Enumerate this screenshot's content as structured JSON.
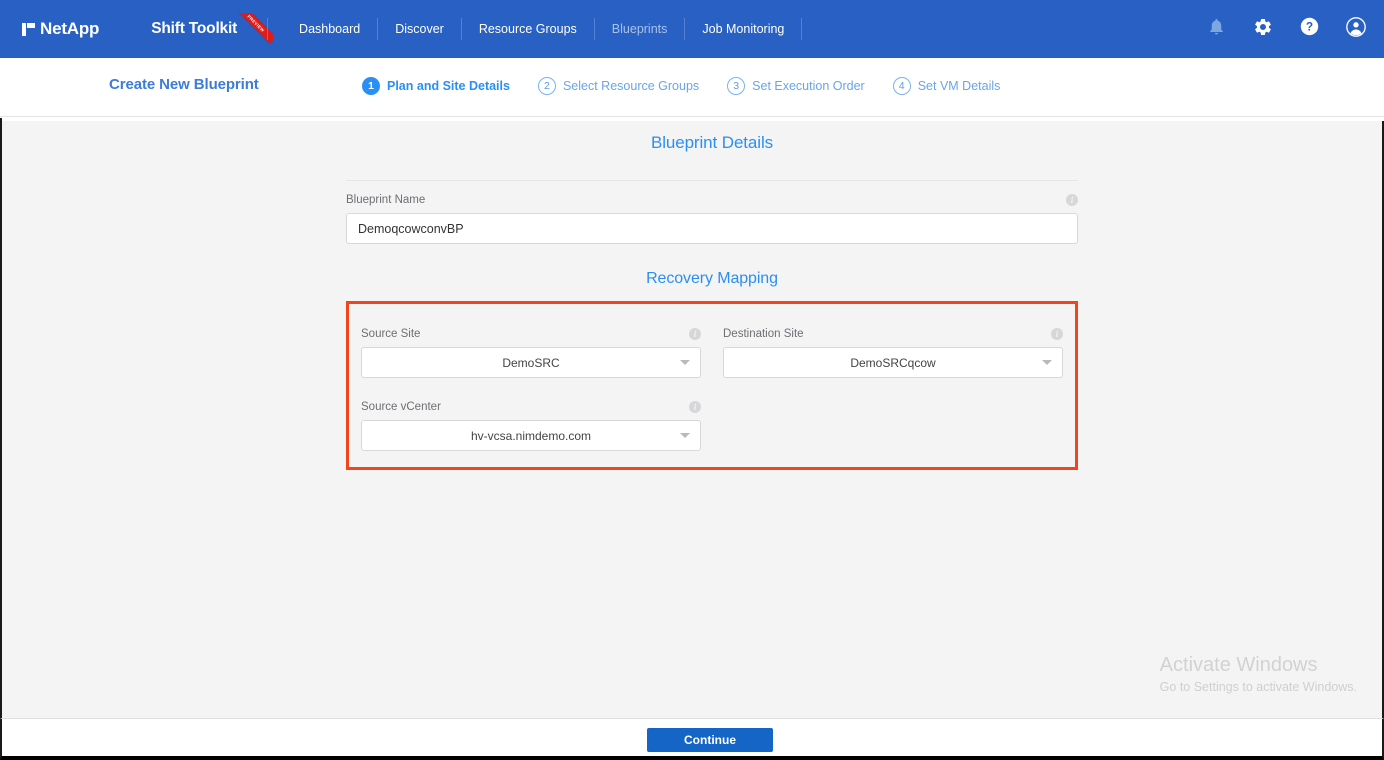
{
  "navbar": {
    "logo_text": "NetApp",
    "brand": "Shift Toolkit",
    "ribbon_label": "PREVIEW",
    "links": [
      {
        "label": "Dashboard",
        "state": "normal"
      },
      {
        "label": "Discover",
        "state": "normal"
      },
      {
        "label": "Resource Groups",
        "state": "normal"
      },
      {
        "label": "Blueprints",
        "state": "dim"
      },
      {
        "label": "Job Monitoring",
        "state": "normal"
      }
    ],
    "icons": [
      {
        "name": "notification-bell-icon"
      },
      {
        "name": "settings-gear-icon"
      },
      {
        "name": "help-icon"
      },
      {
        "name": "user-account-icon"
      }
    ],
    "accent_color": "#2860c4"
  },
  "wizard": {
    "title": "Create New Blueprint",
    "close_label": "✕",
    "steps": [
      {
        "num": "1",
        "label": "Plan and Site Details",
        "active": true
      },
      {
        "num": "2",
        "label": "Select Resource Groups",
        "active": false
      },
      {
        "num": "3",
        "label": "Set Execution Order",
        "active": false
      },
      {
        "num": "4",
        "label": "Set VM Details",
        "active": false
      }
    ]
  },
  "blueprint_details": {
    "heading": "Blueprint Details",
    "name_label": "Blueprint Name",
    "name_value": "DemoqcowconvBP",
    "name_placeholder": "Blueprint Name",
    "info_glyph": "i"
  },
  "recovery_mapping": {
    "heading": "Recovery Mapping",
    "highlight_color": "#f4441e",
    "fields": [
      {
        "label": "Source Site",
        "value": "DemoSRC"
      },
      {
        "label": "Destination Site",
        "value": "DemoSRCqcow"
      },
      {
        "label": "Source vCenter",
        "value": "hv-vcsa.nimdemo.com"
      }
    ]
  },
  "footer": {
    "continue_label": "Continue"
  },
  "watermark": {
    "title": "Activate Windows",
    "subtitle": "Go to Settings to activate Windows."
  }
}
